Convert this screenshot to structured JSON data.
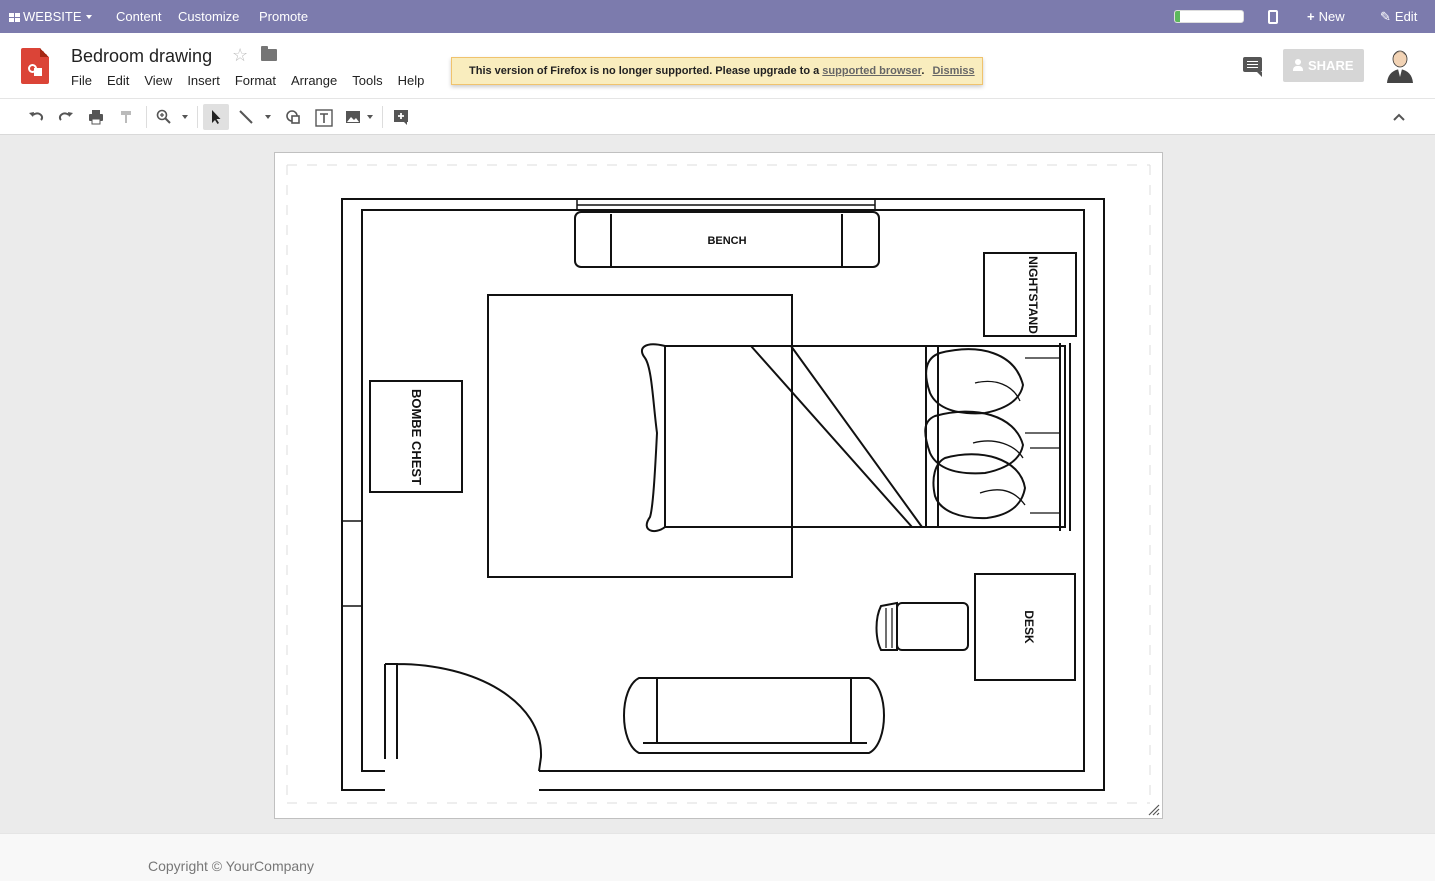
{
  "topbar": {
    "website_label": "WEBSITE",
    "menu": [
      "Content",
      "Customize",
      "Promote"
    ],
    "progress_fraction": 0.07,
    "new_label": "New",
    "edit_label": "Edit",
    "accent_color": "#7c7bad"
  },
  "document": {
    "title": "Bedroom drawing",
    "menu": [
      "File",
      "Edit",
      "View",
      "Insert",
      "Format",
      "Arrange",
      "Tools",
      "Help"
    ]
  },
  "banner": {
    "text": "This version of Firefox is no longer supported. Please upgrade to a",
    "link": "supported browser",
    "dismiss": "Dismiss"
  },
  "share": {
    "label": "SHARE"
  },
  "toolbar": {
    "icons": [
      "undo-icon",
      "redo-icon",
      "print-icon",
      "paint-format-icon",
      "zoom-icon",
      "select-icon",
      "line-icon",
      "shape-icon",
      "textbox-icon",
      "image-icon",
      "add-comment-icon",
      "collapse-icon"
    ]
  },
  "drawing": {
    "labels": {
      "bench": "BENCH",
      "nightstand": "NIGHTSTAND",
      "chest": "BOMBE CHEST",
      "desk": "DESK"
    }
  },
  "footer": {
    "copyright": "Copyright © YourCompany"
  }
}
